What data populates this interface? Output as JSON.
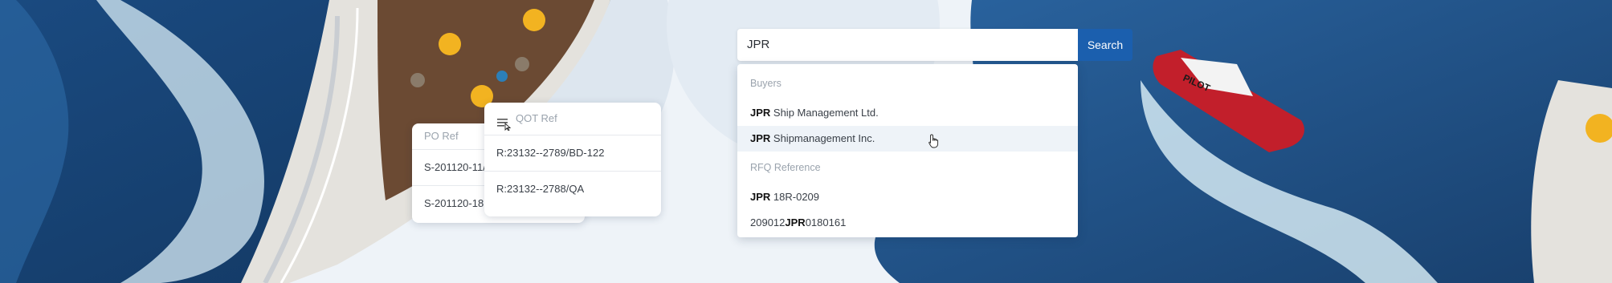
{
  "colors": {
    "accent": "#1b5fae",
    "background": "#eef3f8",
    "sea": "#1d4f86"
  },
  "search": {
    "value": "JPR",
    "button_label": "Search",
    "sections": [
      {
        "title": "Buyers",
        "options": [
          {
            "match": "JPR",
            "rest": " Ship Management Ltd."
          },
          {
            "match": "JPR",
            "rest": " Shipmanagement Inc."
          }
        ]
      },
      {
        "title": "RFQ Reference",
        "options": [
          {
            "match": "JPR",
            "rest": " 18R-0209"
          },
          {
            "prefix": "209012",
            "match": "JPR",
            "rest": "0180161"
          }
        ]
      }
    ]
  },
  "po_card": {
    "header": "PO Ref",
    "rows": [
      "S-201120-11/...",
      "S-201120-181..."
    ]
  },
  "qot_card": {
    "header": "QOT Ref",
    "icon": "filter-list-icon",
    "rows": [
      "R:23132--2789/BD-122",
      "R:23132--2788/QA"
    ]
  },
  "boat": {
    "label": "PILOT"
  }
}
